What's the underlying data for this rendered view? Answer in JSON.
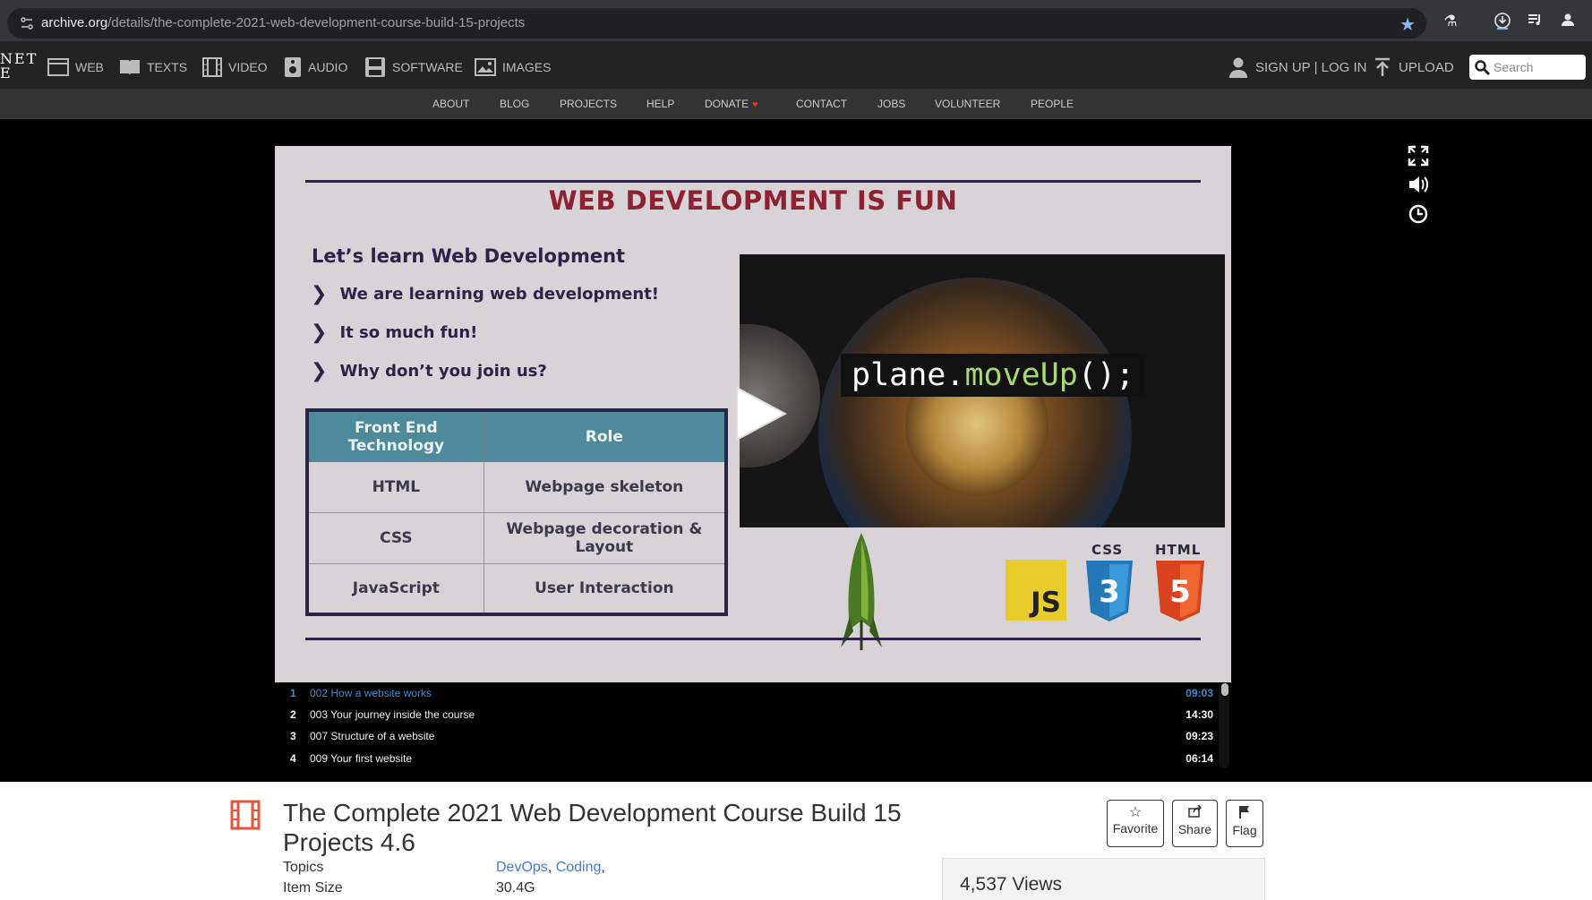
{
  "browser": {
    "url_host": "archive.org",
    "url_path": "/details/the-complete-2021-web-development-course-build-15-projects"
  },
  "ia_nav": {
    "logo_fragment_line1": "NET",
    "logo_fragment_line2": "E",
    "media": [
      {
        "label": "WEB",
        "icon": "web-icon"
      },
      {
        "label": "TEXTS",
        "icon": "texts-icon"
      },
      {
        "label": "VIDEO",
        "icon": "video-icon"
      },
      {
        "label": "AUDIO",
        "icon": "audio-icon"
      },
      {
        "label": "SOFTWARE",
        "icon": "software-icon"
      },
      {
        "label": "IMAGES",
        "icon": "images-icon"
      }
    ],
    "signup_login": "SIGN UP | LOG IN",
    "upload": "UPLOAD",
    "search_placeholder": "Search"
  },
  "sub_nav": {
    "items": [
      "ABOUT",
      "BLOG",
      "PROJECTS",
      "HELP",
      "DONATE",
      "CONTACT",
      "JOBS",
      "VOLUNTEER",
      "PEOPLE"
    ]
  },
  "slide": {
    "title": "WEB DEVELOPMENT IS FUN",
    "subtitle": "Let’s learn Web Development",
    "bullets": [
      "We are learning web development!",
      "It so much fun!",
      "Why don’t you join us?"
    ],
    "table_headers": [
      "Front End Technology",
      "Role"
    ],
    "table_rows": [
      [
        "HTML",
        "Webpage skeleton"
      ],
      [
        "CSS",
        "Webpage decoration & Layout"
      ],
      [
        "JavaScript",
        "User Interaction"
      ]
    ],
    "code_object": "plane.",
    "code_method": "moveUp",
    "code_tail": "();",
    "badge_js": "JS",
    "badge_css_label": "CSS",
    "badge_css_digit": "3",
    "badge_html_label": "HTML",
    "badge_html_digit": "5"
  },
  "player_icons": [
    "fullscreen-icon",
    "volume-icon",
    "clock-icon"
  ],
  "playlist": [
    {
      "num": "1",
      "title": "002 How a website works",
      "duration": "09:03",
      "active": true
    },
    {
      "num": "2",
      "title": "003 Your journey inside the course",
      "duration": "14:30",
      "active": false
    },
    {
      "num": "3",
      "title": "007 Structure of a website",
      "duration": "09:23",
      "active": false
    },
    {
      "num": "4",
      "title": "009 Your first website",
      "duration": "06:14",
      "active": false
    }
  ],
  "item": {
    "title": "The Complete 2021 Web Development Course Build 15 Projects 4.6",
    "topics_label": "Topics",
    "topics": [
      "DevOps",
      "Coding"
    ],
    "topics_sep": ", ",
    "topics_trail": ",",
    "size_label": "Item Size",
    "size_value": "30.4G",
    "views": "4,537 Views"
  },
  "actions": {
    "favorite": "Favorite",
    "share": "Share",
    "flag": "Flag"
  },
  "colors": {
    "accent_link": "#4a7bd2",
    "active_track": "#428bca",
    "slide_title": "#8e2233",
    "heart": "#e4322a"
  }
}
